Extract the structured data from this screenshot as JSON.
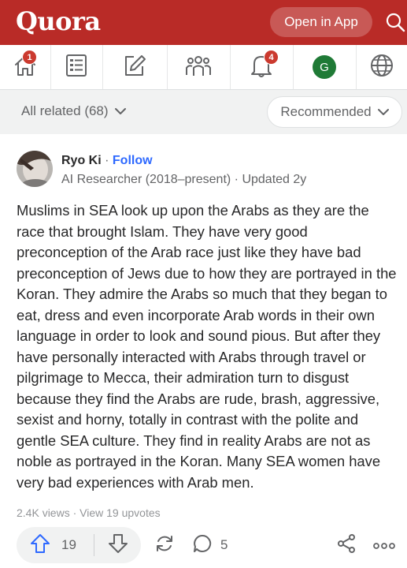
{
  "header": {
    "logo_text": "Quora",
    "open_app_label": "Open in App",
    "brand_color": "#b92b27"
  },
  "nav": {
    "items": [
      {
        "name": "home",
        "icon": "home-icon",
        "badge": "1"
      },
      {
        "name": "following",
        "icon": "list-icon"
      },
      {
        "name": "answer",
        "icon": "edit-icon"
      },
      {
        "name": "spaces",
        "icon": "people-icon"
      },
      {
        "name": "notifications",
        "icon": "bell-icon",
        "badge": "4"
      },
      {
        "name": "profile",
        "icon": "avatar",
        "avatar_letter": "G"
      },
      {
        "name": "language",
        "icon": "globe-icon"
      }
    ]
  },
  "filters": {
    "related_label": "All related (68)",
    "sort_label": "Recommended"
  },
  "answer": {
    "author_name": "Ryo Ki",
    "separator": "·",
    "follow_label": "Follow",
    "credential": "AI Researcher (2018–present) · Updated 2y",
    "text": "Muslims in SEA look up upon the Arabs as they are the race that brought Islam. They have very good preconception of the Arab race just like they have bad preconception of Jews due to how they are portrayed in the Koran. They admire the Arabs so much that they began to eat, dress and even incorporate Arab words in their own language in order to look and sound pious. But after they have personally interacted with Arabs through travel or pilgrimage to Mecca, their admiration turn to disgust because they find the Arabs are rude, brash, aggressive, sexist and horny, totally in contrast with the polite and gentle SEA culture. They find in reality Arabs are not as noble as portrayed in the Koran. Many SEA women have very bad experiences with Arab men.",
    "stats": "2.4K views · View 19 upvotes",
    "upvotes": "19",
    "comments": "5"
  }
}
